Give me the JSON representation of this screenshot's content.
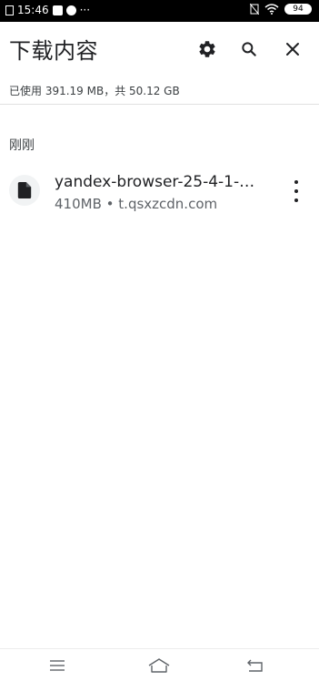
{
  "status_bar": {
    "time": "15:46",
    "more_indicator": "···",
    "battery": "94"
  },
  "header": {
    "title": "下载内容",
    "icons": [
      "gear-icon",
      "search-icon",
      "close-icon"
    ]
  },
  "storage_info": "已使用 391.19 MB，共 50.12 GB",
  "section_title": "刚刚",
  "downloads": [
    {
      "name": "yandex-browser-25-4-1-…",
      "size": "410MB",
      "separator": "•",
      "source": "t.qsxzcdn.com",
      "icon": "file-icon"
    }
  ],
  "nav_bar": {
    "icons": [
      "menu-icon",
      "home-icon",
      "back-icon"
    ]
  },
  "colors": {
    "text_primary": "#202124",
    "text_secondary": "#5f6368",
    "icon_bg": "#f1f3f4"
  }
}
